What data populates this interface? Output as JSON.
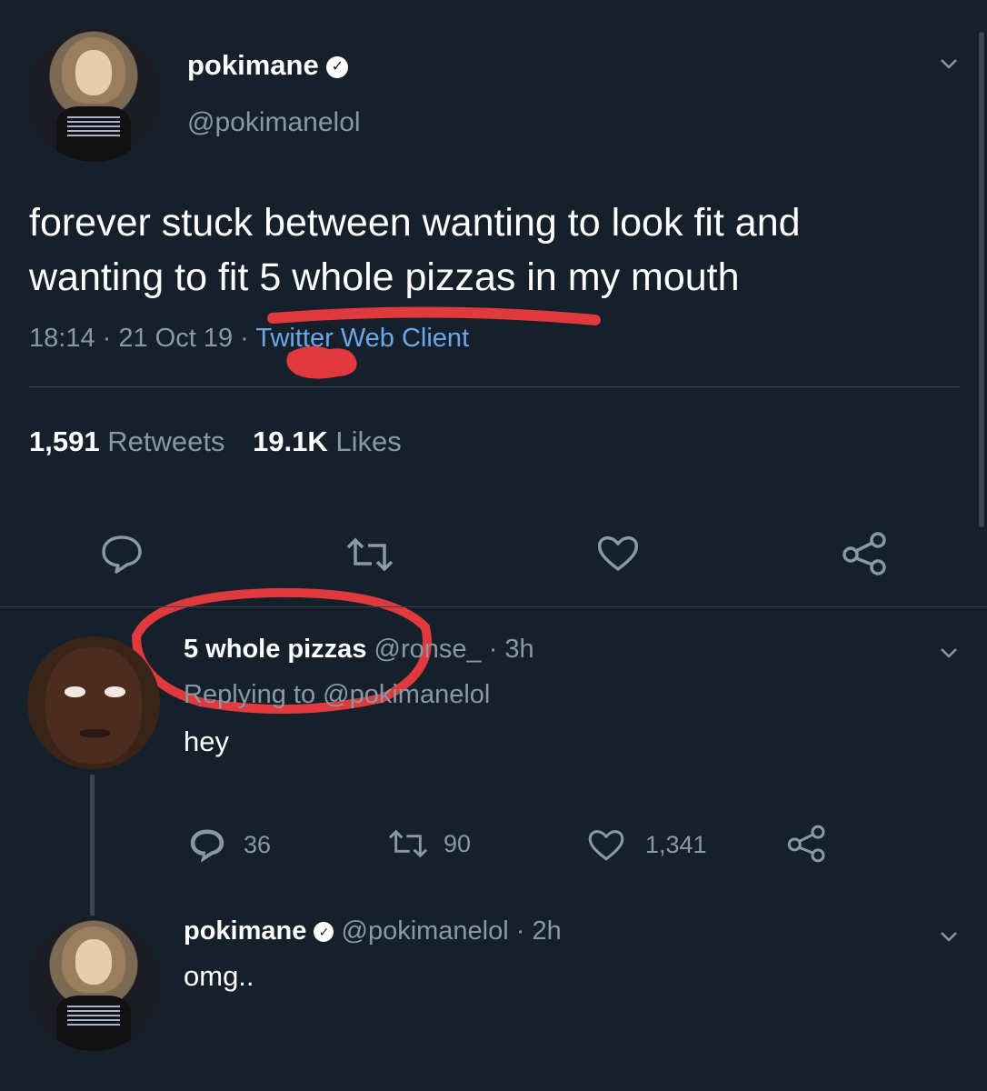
{
  "main_tweet": {
    "display_name": "pokimane",
    "handle": "@pokimanelol",
    "text_line1": "forever stuck between wanting to look fit and",
    "text_line2": "wanting to fit 5 whole pizzas in my mouth",
    "time": "18:14 · 21 Oct 19 ·",
    "client": "Twitter Web Client",
    "retweets_count": "1,591",
    "retweets_label": "Retweets",
    "likes_count": "19.1K",
    "likes_label": "Likes"
  },
  "reply1": {
    "display_name": "5 whole pizzas",
    "handle": "@ronse_",
    "time": "· 3h",
    "replying_to": "Replying to @pokimanelol",
    "text": "hey",
    "reply_count": "36",
    "retweet_count": "90",
    "like_count": "1,341"
  },
  "reply2": {
    "display_name": "pokimane",
    "handle": "@pokimanelol",
    "time": "· 2h",
    "text": "omg.."
  },
  "colors": {
    "background": "#15202b",
    "text": "#ffffff",
    "muted": "#8899a6",
    "link": "#6aa8ea",
    "annotation": "#e0393e"
  }
}
